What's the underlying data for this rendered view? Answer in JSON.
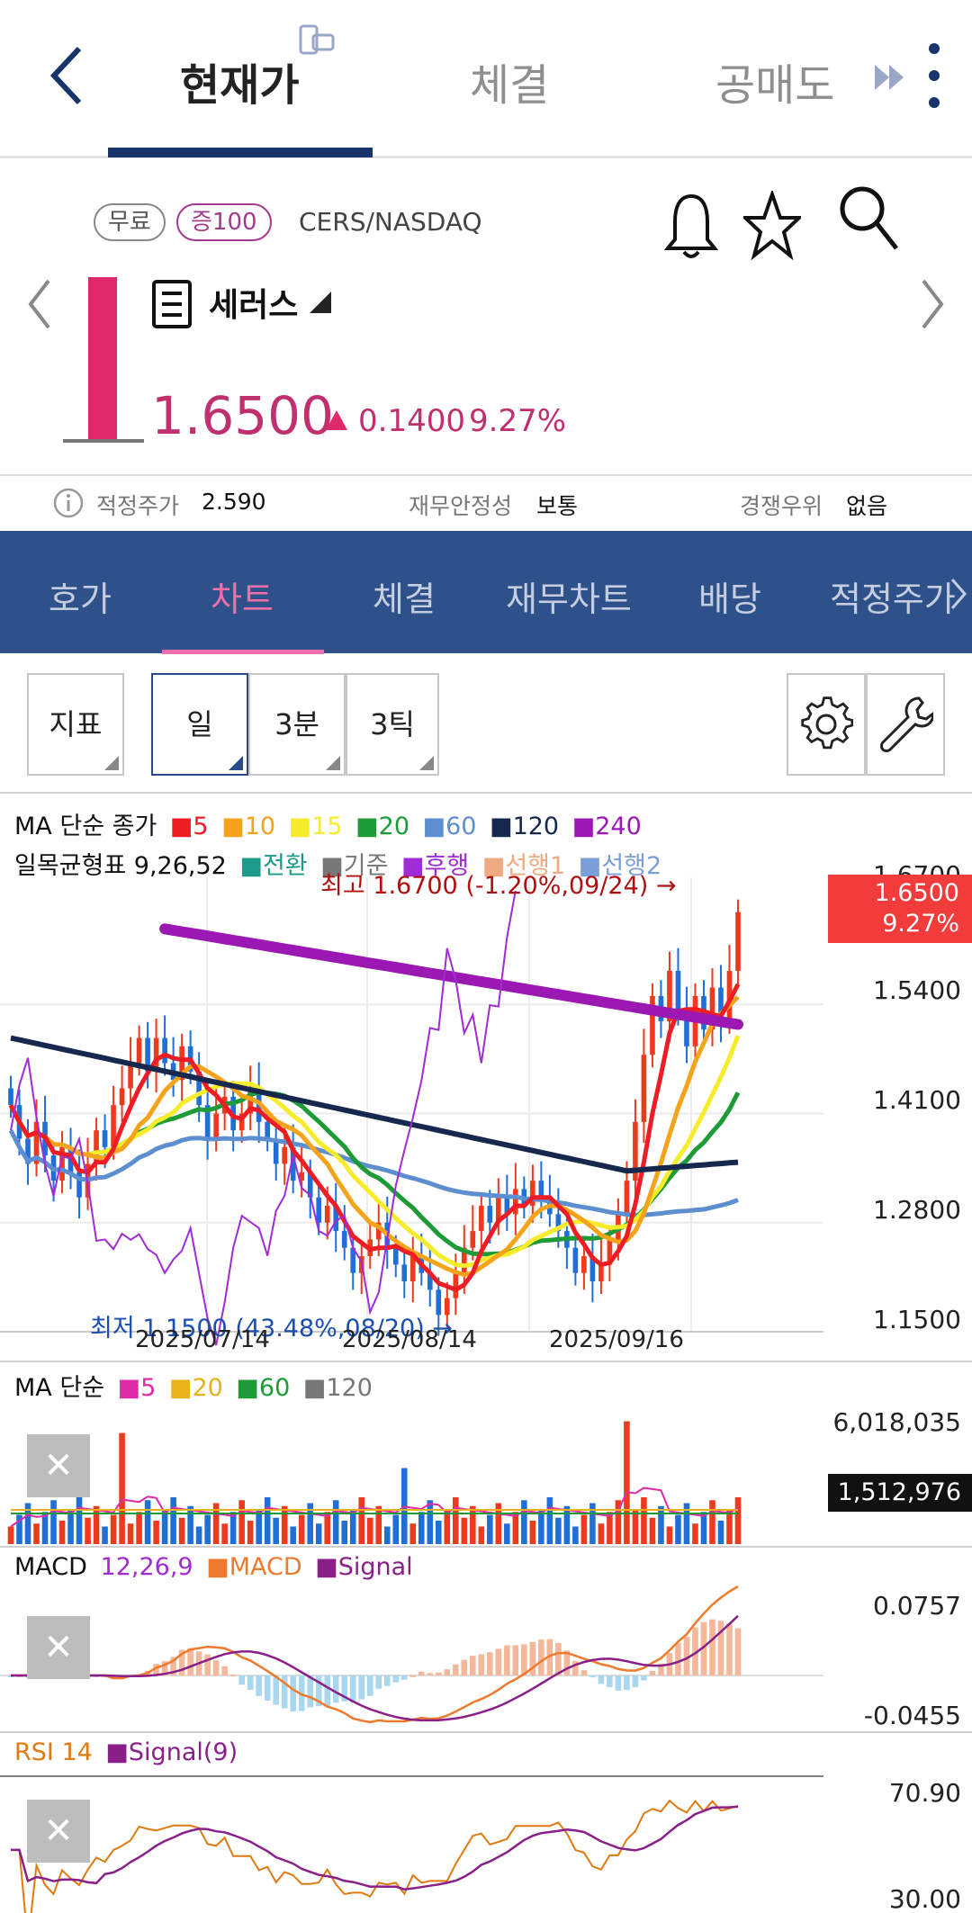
{
  "top_tabs": [
    "현재가",
    "체결",
    "공매도"
  ],
  "stock": {
    "badges": [
      "무료",
      "증100"
    ],
    "ticker": "CERS/NASDAQ",
    "name": "세러스",
    "price": "1.6500",
    "change": "0.1400",
    "change_pct": "9.27%"
  },
  "info": {
    "fair_label": "적정주가",
    "fair_value": "2.590",
    "stability_label": "재무안정성",
    "stability_value": "보통",
    "advantage_label": "경쟁우위",
    "advantage_value": "없음"
  },
  "sub_tabs": [
    "호가",
    "차트",
    "체결",
    "재무차트",
    "배당",
    "적정주가"
  ],
  "toolbar": {
    "indicator": "지표",
    "day": "일",
    "min3": "3분",
    "tick3": "3틱"
  },
  "colors": {
    "accent": "#2f5189",
    "up": "#e0296a",
    "candle_up": "#ec3a1f",
    "candle_down": "#1f6fd6",
    "ma5": "#ee1c25",
    "ma10": "#f5a31b",
    "ma15": "#f7ec2b",
    "ma20": "#1c9b37",
    "ma60": "#5d8fd0",
    "ma120": "#17284f",
    "ma240": "#9b18b3"
  },
  "main_chart": {
    "ma_title": "MA 단순 종가",
    "ma_periods": [
      "5",
      "10",
      "15",
      "20",
      "60",
      "120",
      "240"
    ],
    "ichimoku_title": "일목균형표 9,26,52",
    "ichimoku_items": [
      "전환",
      "기준",
      "후행",
      "선행1",
      "선행2"
    ],
    "high_annot": "최고 1.6700 (-1.20%,09/24) →",
    "low_annot": "최저 1.1500 (43.48%,08/20) →",
    "current_price": "1.6500",
    "current_pct": "9.27%",
    "y_ticks": [
      "1.6700",
      "1.5400",
      "1.4100",
      "1.2800",
      "1.1500"
    ],
    "x_ticks": [
      "2025/07/14",
      "2025/08/14",
      "2025/09/16"
    ]
  },
  "volume_chart": {
    "title": "MA 단순",
    "ma_periods": [
      "5",
      "20",
      "60",
      "120"
    ],
    "y_max": "6,018,035",
    "current": "1,512,976"
  },
  "macd_chart": {
    "title": "MACD",
    "params": "12,26,9",
    "items": [
      "MACD",
      "Signal"
    ],
    "y_ticks": [
      "0.0757",
      "-0.0455"
    ]
  },
  "rsi_chart": {
    "title": "RSI 14",
    "items": [
      "Signal(9)"
    ],
    "y_ticks": [
      "70.90",
      "30.00"
    ]
  },
  "chart_data": {
    "type": "candlestick",
    "x_ticks": [
      "2025/07/14",
      "2025/08/14",
      "2025/09/16"
    ],
    "ylim": [
      1.15,
      1.67
    ],
    "close": [
      1.42,
      1.38,
      1.35,
      1.4,
      1.36,
      1.33,
      1.37,
      1.34,
      1.31,
      1.35,
      1.39,
      1.37,
      1.42,
      1.44,
      1.47,
      1.5,
      1.46,
      1.5,
      1.47,
      1.45,
      1.49,
      1.46,
      1.42,
      1.38,
      1.41,
      1.43,
      1.39,
      1.41,
      1.44,
      1.4,
      1.38,
      1.35,
      1.37,
      1.33,
      1.34,
      1.31,
      1.28,
      1.3,
      1.27,
      1.25,
      1.22,
      1.24,
      1.26,
      1.28,
      1.25,
      1.23,
      1.21,
      1.24,
      1.22,
      1.2,
      1.17,
      1.19,
      1.22,
      1.25,
      1.27,
      1.3,
      1.28,
      1.31,
      1.29,
      1.32,
      1.3,
      1.33,
      1.31,
      1.29,
      1.27,
      1.25,
      1.22,
      1.24,
      1.21,
      1.23,
      1.26,
      1.29,
      1.33,
      1.4,
      1.48,
      1.55,
      1.52,
      1.58,
      1.53,
      1.49,
      1.55,
      1.51,
      1.56,
      1.52,
      1.58,
      1.65
    ]
  }
}
